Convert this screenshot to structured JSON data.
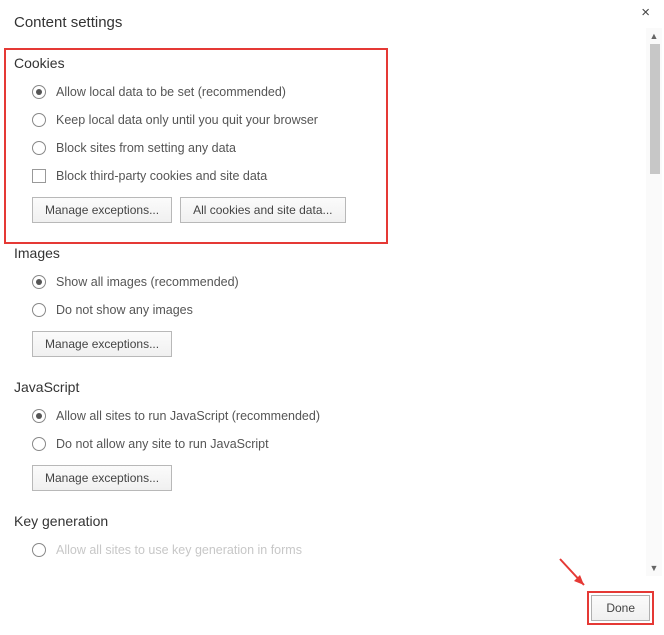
{
  "dialog_title": "Content settings",
  "close_glyph": "×",
  "sections": {
    "cookies": {
      "title": "Cookies",
      "options": [
        "Allow local data to be set (recommended)",
        "Keep local data only until you quit your browser",
        "Block sites from setting any data"
      ],
      "checkbox_label": "Block third-party cookies and site data",
      "buttons": {
        "manage": "Manage exceptions...",
        "all": "All cookies and site data..."
      }
    },
    "images": {
      "title": "Images",
      "options": [
        "Show all images (recommended)",
        "Do not show any images"
      ],
      "buttons": {
        "manage": "Manage exceptions..."
      }
    },
    "javascript": {
      "title": "JavaScript",
      "options": [
        "Allow all sites to run JavaScript (recommended)",
        "Do not allow any site to run JavaScript"
      ],
      "buttons": {
        "manage": "Manage exceptions..."
      }
    },
    "keygen": {
      "title": "Key generation",
      "options": [
        "Allow all sites to use key generation in forms"
      ]
    }
  },
  "done_label": "Done"
}
